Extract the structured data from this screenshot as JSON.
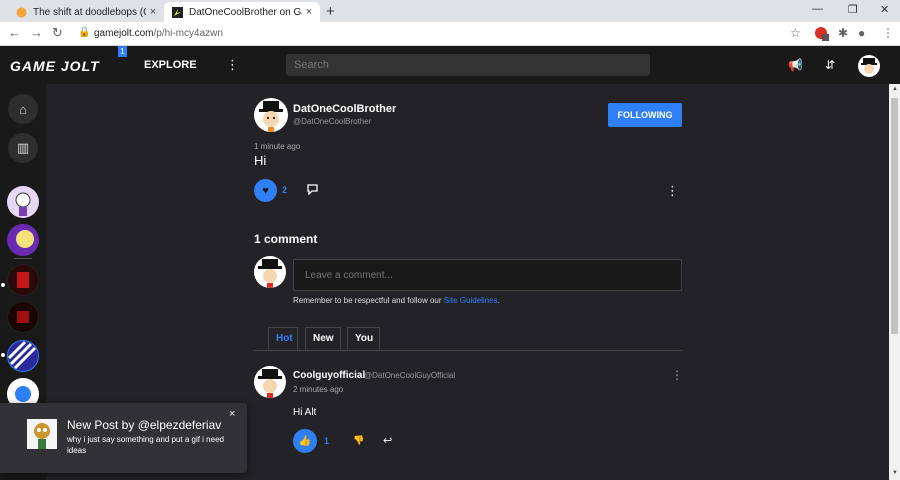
{
  "browser": {
    "tabs": [
      {
        "title": "The shift at doodlebops (Official)",
        "active": false
      },
      {
        "title": "DatOneCoolBrother on Game Jolt",
        "active": true
      }
    ],
    "new_tab": "+",
    "close": "×",
    "window_controls": [
      "—",
      "❐",
      "✕"
    ],
    "url_host": "gamejolt.com",
    "url_path": "/p/hi-mcy4azwn",
    "icons": {
      "back": "←",
      "forward": "→",
      "reload": "↻",
      "lock": "🔒",
      "star": "☆",
      "extensions": "✱",
      "profile": "●",
      "menu": "⋮"
    }
  },
  "topnav": {
    "logo": "GAME JOLT",
    "badge": "1",
    "explore": "EXPLORE",
    "search_placeholder": "Search",
    "icons": {
      "kebab": "⋮",
      "announce": "📢",
      "activity": "⇵"
    }
  },
  "rail": {
    "icons": {
      "home": "⌂",
      "library": "▥"
    }
  },
  "post": {
    "author_name": "DatOneCoolBrother",
    "author_handle": "@DatOneCoolBrother",
    "follow_label": "FOLLOWING",
    "time": "1 minute ago",
    "body": "Hi",
    "like_count": "2",
    "icons": {
      "like": "♥",
      "comment": "🗨",
      "menu": "⋮"
    }
  },
  "comments": {
    "title": "1 comment",
    "input_placeholder": "Leave a comment...",
    "guidelines_text": "Remember to be respectful and follow our",
    "guidelines_link": "Site Guidelines",
    "guidelines_end": ".",
    "tabs": [
      "Hot",
      "New",
      "You"
    ],
    "items": [
      {
        "name": "Coolguyofficial",
        "handle": "@DatOneCoolGuyOfficial",
        "time": "2 minutes ago",
        "body": "Hi Alt",
        "like_count": "1",
        "icons": {
          "like": "👍",
          "dislike": "👎",
          "reply": "↩",
          "menu": "⋮"
        }
      }
    ]
  },
  "toast": {
    "title": "New Post by @elpezdeferiav",
    "text": "why i just say something and put a gif i need ideas",
    "close": "×"
  },
  "colors": {
    "accent": "#2f7ff7",
    "page_bg": "#232226",
    "chrome_bg": "#191919"
  }
}
